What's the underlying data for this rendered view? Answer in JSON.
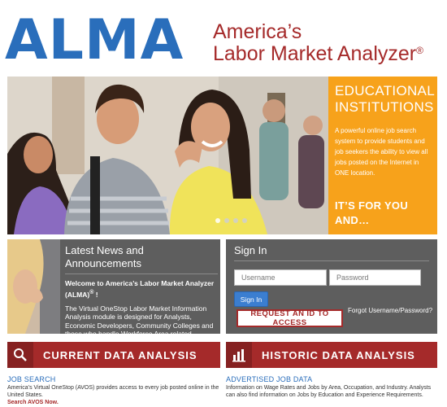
{
  "header": {
    "logo": "ALMA",
    "tagline_line1": "America’s",
    "tagline_line2": "Labor Market Analyzer",
    "registered_mark": "®"
  },
  "hero": {
    "title_line1": "EDUCATIONAL",
    "title_line2": "INSTITUTIONS",
    "description": "A powerful online job search system to provide students and job seekers the ability to view all jobs posted on the Internet in ONE location.",
    "cta_line1": "IT’S FOR YOU",
    "cta_line2": "AND…",
    "slide_count": 4,
    "active_slide": 1,
    "colors": {
      "panel": "#f7a21b"
    }
  },
  "news": {
    "heading": "Latest News and Announcements",
    "subheading": "Welcome to America’s Labor Market Analyzer (ALMA)",
    "subheading_mark": "®",
    "subheading_end": " !",
    "body": "The Virtual OneStop Labor Market Information Analysis module is designed for Analysts, Economic Developers, Community Colleges and those who handle Workforce Area related information."
  },
  "signin": {
    "title": "Sign In",
    "username_placeholder": "Username",
    "password_placeholder": "Password",
    "signin_button": "Sign In",
    "request_button": "REQUEST AN ID TO ACCESS",
    "forgot_link": "Forgot Username/Password?"
  },
  "sections": {
    "current": {
      "label": "CURRENT DATA ANALYSIS",
      "icon": "search-icon"
    },
    "historic": {
      "label": "HISTORIC DATA ANALYSIS",
      "icon": "bar-chart-icon"
    }
  },
  "bottom": {
    "left": {
      "title": "JOB SEARCH",
      "text": "America’s Virtual OneStop (AVOS) provides access to every job posted online in the United States.",
      "link": "Search AVOS Now."
    },
    "right": {
      "title": "ADVERTISED JOB DATA",
      "text": "Information on Wage Rates and Jobs by Area, Occupation, and Industry. Analysts can also find information on Jobs by Education and Experience Requirements."
    }
  },
  "colors": {
    "brand_blue": "#2a6ebb",
    "brand_red": "#a52a2a",
    "panel_gray": "#5e5e5e"
  }
}
